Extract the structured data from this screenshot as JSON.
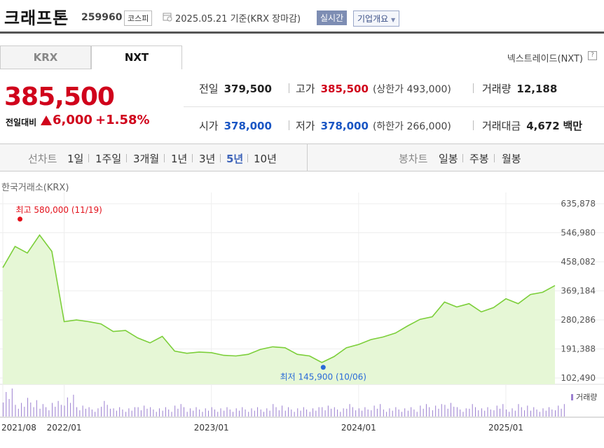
{
  "header": {
    "company_name": "크래프톤",
    "code": "259960",
    "market": "코스피",
    "date_text": "2025.05.21  기준(KRX 장마감)",
    "realtime_label": "실시간",
    "company_info_label": "기업개요"
  },
  "tabs": [
    {
      "label": "KRX",
      "active": false
    },
    {
      "label": "NXT",
      "active": true
    }
  ],
  "nxt_label": "넥스트레이드(NXT)",
  "help_label": "?",
  "quote": {
    "price": "385,500",
    "change_label": "전일대비",
    "change": "6,000",
    "change_pct": "+1.58%",
    "up_color": "#d0021b"
  },
  "stats": {
    "prev_close": {
      "label": "전일",
      "value": "379,500"
    },
    "high": {
      "label": "고가",
      "value": "385,500",
      "sub": "(상한가 493,000)"
    },
    "volume": {
      "label": "거래량",
      "value": "12,188"
    },
    "open": {
      "label": "시가",
      "value": "378,000"
    },
    "low": {
      "label": "저가",
      "value": "378,000",
      "sub": "(하한가 266,000)"
    },
    "amount": {
      "label": "거래대금",
      "value": "4,672",
      "unit": "백만"
    }
  },
  "period_bar": {
    "line_label": "선차트",
    "periods": [
      "1일",
      "1주일",
      "3개월",
      "1년",
      "3년",
      "5년",
      "10년"
    ],
    "active_period": "5년",
    "candle_label": "봉차트",
    "candles": [
      "일봉",
      "주봉",
      "월봉"
    ]
  },
  "source_label": "한국거래소(KRX)",
  "chart_data": {
    "type": "area",
    "x": [
      "2021/08",
      "2021/09",
      "2021/10",
      "2021/11",
      "2021/12",
      "2022/01",
      "2022/02",
      "2022/03",
      "2022/04",
      "2022/05",
      "2022/06",
      "2022/07",
      "2022/08",
      "2022/09",
      "2022/10",
      "2022/11",
      "2022/12",
      "2023/01",
      "2023/02",
      "2023/03",
      "2023/04",
      "2023/05",
      "2023/06",
      "2023/07",
      "2023/08",
      "2023/09",
      "2023/10",
      "2023/11",
      "2023/12",
      "2024/01",
      "2024/02",
      "2024/03",
      "2024/04",
      "2024/05",
      "2024/06",
      "2024/07",
      "2024/08",
      "2024/09",
      "2024/10",
      "2024/11",
      "2024/12",
      "2025/01",
      "2025/02",
      "2025/03",
      "2025/04",
      "2025/05"
    ],
    "y": [
      440000,
      505000,
      485000,
      540000,
      490000,
      275000,
      280000,
      275000,
      268000,
      245000,
      248000,
      225000,
      210000,
      230000,
      185000,
      178000,
      182000,
      180000,
      172000,
      170000,
      175000,
      190000,
      198000,
      195000,
      175000,
      170000,
      150000,
      168000,
      195000,
      205000,
      220000,
      228000,
      240000,
      262000,
      282000,
      290000,
      335000,
      320000,
      330000,
      305000,
      318000,
      345000,
      330000,
      358000,
      365000,
      385500
    ],
    "ylim": [
      102490,
      635878
    ],
    "y_ticks": [
      "635,878",
      "546,980",
      "458,082",
      "369,184",
      "280,286",
      "191,388",
      "102,490"
    ],
    "x_tick_labels": [
      "2021/08",
      "2022/01",
      "2023/01",
      "2024/01",
      "2025/01"
    ],
    "high_annotation": {
      "label": "최고",
      "value": "580,000 (11/19)",
      "x": "2021/11",
      "y": 580000,
      "color": "#e3101a"
    },
    "low_annotation": {
      "label": "최저",
      "value": "145,900 (10/06)",
      "x": "2023/10",
      "y": 145900,
      "color": "#2a6bd8"
    },
    "line_color": "#7ccf3a",
    "fill_color": "#e6f7d6",
    "volume_label": "거래량",
    "volume": [
      9,
      5,
      6,
      4,
      5,
      7,
      4,
      3,
      5,
      3,
      3,
      4,
      3,
      3,
      4,
      3,
      3,
      3,
      3,
      3,
      3,
      3,
      4,
      3,
      3,
      3,
      4,
      3,
      4,
      3,
      4,
      3,
      3,
      3,
      4,
      4,
      5,
      3,
      4,
      3,
      4,
      3,
      4,
      3,
      3,
      4
    ],
    "volume_color": "#9b7fd0",
    "grid": true
  }
}
